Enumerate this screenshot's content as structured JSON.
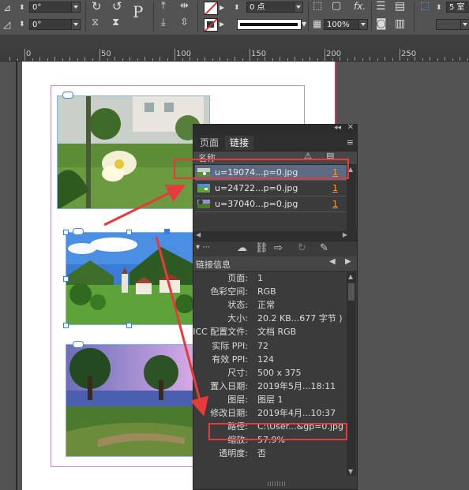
{
  "toolbar": {
    "angle1": "0°",
    "angle2": "0°",
    "stroke_weight": "0 点",
    "opacity": "100%",
    "column_count": "5 室"
  },
  "ruler": {
    "labels": [
      "0",
      "50",
      "100",
      "150",
      "200",
      "250"
    ]
  },
  "links_panel": {
    "tabs": [
      "页面",
      "链接"
    ],
    "column_name_header": "名称",
    "links": [
      {
        "name": "u=19074...p=0.jpg",
        "page": "1"
      },
      {
        "name": "u=24722...p=0.jpg",
        "page": "1"
      },
      {
        "name": "u=37040...p=0.jpg",
        "page": "1"
      }
    ],
    "info_title": "链接信息",
    "info": [
      {
        "key": "页面:",
        "value": "1"
      },
      {
        "key": "色彩空间:",
        "value": "RGB"
      },
      {
        "key": "状态:",
        "value": "正常"
      },
      {
        "key": "大小:",
        "value": "20.2 KB...677 字节 )"
      },
      {
        "key": "ICC 配置文件:",
        "value": "文档 RGB"
      },
      {
        "key": "实际 PPI:",
        "value": "72"
      },
      {
        "key": "有效 PPI:",
        "value": "124"
      },
      {
        "key": "尺寸:",
        "value": "500 x 375"
      },
      {
        "key": "置入日期:",
        "value": "2019年5月...18:11"
      },
      {
        "key": "图层:",
        "value": "图层 1"
      },
      {
        "key": "修改日期:",
        "value": "2019年4月...10:37"
      },
      {
        "key": "路径:",
        "value": "C:\\User...&gp=0.jpg"
      },
      {
        "key": "缩放:",
        "value": "57.9%"
      },
      {
        "key": "透明度:",
        "value": "否"
      }
    ]
  },
  "colors": {
    "accent_red": "#e63b3b",
    "page_link_orange": "#ff9a33",
    "selection_blue": "#4a88d8"
  }
}
